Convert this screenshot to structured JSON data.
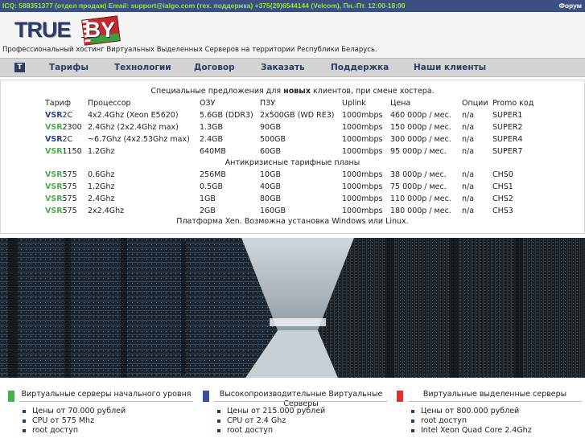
{
  "topbar": {
    "contacts": "ICQ: 588351377 (отдел продаж) Email: support@ialgo.com (тех. поддержка) +375(29)6544144 (Velcom), Пн.-Пт. 12:00-18:00",
    "forum": "Форум"
  },
  "header": {
    "logo_text": "TRUE",
    "logo_suffix": ".BY",
    "tagline": "Профессиональный хостинг Виртуальных Выделенных Серверов на территории Республики Беларусь."
  },
  "nav": {
    "home_icon": "T",
    "items": [
      "Тарифы",
      "Технологии",
      "Договор",
      "Заказать",
      "Поддержка",
      "Наши клиенты"
    ]
  },
  "offers": {
    "intro_prefix": "Специальные предложения для ",
    "intro_bold": "новых",
    "intro_suffix": " клиентов, при смене хостера.",
    "columns": [
      "Тариф",
      "Процессор",
      "ОЗУ",
      "ПЗУ",
      "Uplink",
      "Цена",
      "Опции",
      "Promo код"
    ],
    "special_rows": [
      {
        "prefix": "VSR",
        "prefix_color": "blue",
        "suffix": "2C",
        "cpu": "4x2.4Ghz (Xeon E5620)",
        "ram": "5.6GB (DDR3)",
        "disk": "2x500GB (WD RE3)",
        "uplink": "1000mbps",
        "price": "460 000р / мес.",
        "options": "n/a",
        "promo": "SUPER1"
      },
      {
        "prefix": "VSR",
        "prefix_color": "green",
        "suffix": "2300",
        "cpu": "2.4Ghz (2x2.4Ghz max)",
        "ram": "1.3GB",
        "disk": "90GB",
        "uplink": "1000mbps",
        "price": "150 000р / мес.",
        "options": "n/a",
        "promo": "SUPER2"
      },
      {
        "prefix": "VSR",
        "prefix_color": "blue",
        "suffix": "2C",
        "cpu": "~6.7Ghz (4x2.53Ghz max)",
        "ram": "2.4GB",
        "disk": "500GB",
        "uplink": "1000mbps",
        "price": "300 000р / мес.",
        "options": "n/a",
        "promo": "SUPER4"
      },
      {
        "prefix": "VSR",
        "prefix_color": "green",
        "suffix": "1150",
        "cpu": "1.2Ghz",
        "ram": "640MB",
        "disk": "60GB",
        "uplink": "1000mbps",
        "price": "95 000р / мес.",
        "options": "n/a",
        "promo": "SUPER7"
      }
    ],
    "crisis_title": "Антикризисные тарифные планы",
    "crisis_rows": [
      {
        "prefix": "VSR",
        "prefix_color": "green",
        "suffix": "575",
        "cpu": "0.6Ghz",
        "ram": "256MB",
        "disk": "10GB",
        "uplink": "1000mbps",
        "price": "38 000р / мес.",
        "options": "n/a",
        "promo": "CHS0"
      },
      {
        "prefix": "VSR",
        "prefix_color": "green",
        "suffix": "575",
        "cpu": "1.2Ghz",
        "ram": "0.5GB",
        "disk": "40GB",
        "uplink": "1000mbps",
        "price": "75 000р / мес.",
        "options": "n/a",
        "promo": "CHS1"
      },
      {
        "prefix": "VSR",
        "prefix_color": "green",
        "suffix": "575",
        "cpu": "2.4Ghz",
        "ram": "1GB",
        "disk": "80GB",
        "uplink": "1000mbps",
        "price": "110 000р / мес.",
        "options": "n/a",
        "promo": "CHS2"
      },
      {
        "prefix": "VSR",
        "prefix_color": "green",
        "suffix": "575",
        "cpu": "2x2.4Ghz",
        "ram": "2GB",
        "disk": "160GB",
        "uplink": "1000mbps",
        "price": "180 000р / мес.",
        "options": "n/a",
        "promo": "CHS3"
      }
    ],
    "footer": "Платформа Xen. Возможна установка Windows или Linux."
  },
  "features": [
    {
      "title": "Виртуальные серверы начального уровня",
      "color": "#4ab04a",
      "items": [
        "Цены от 70.000 рублей",
        "CPU от 575 Mhz",
        "root доступ"
      ]
    },
    {
      "title": "Высокопроизводительные Виртуальные Серверы",
      "color": "#3b4f9a",
      "items": [
        "Цены от 215.000 рублей",
        "CPU от 2.4 Ghz",
        "root доступ"
      ]
    },
    {
      "title": "Виртуальные выделенные серверы",
      "color": "#e03030",
      "items": [
        "Цены от 800.000 рублей",
        "root доступ",
        "Intel Xeon Quad Core 2.4Ghz"
      ]
    }
  ],
  "colors": {
    "topbar": "#3b4f80",
    "topbar_text": "#9be34a",
    "nav_bg": "#d4d4d4",
    "accent_blue": "#2a4690",
    "accent_green": "#4ab04a"
  }
}
